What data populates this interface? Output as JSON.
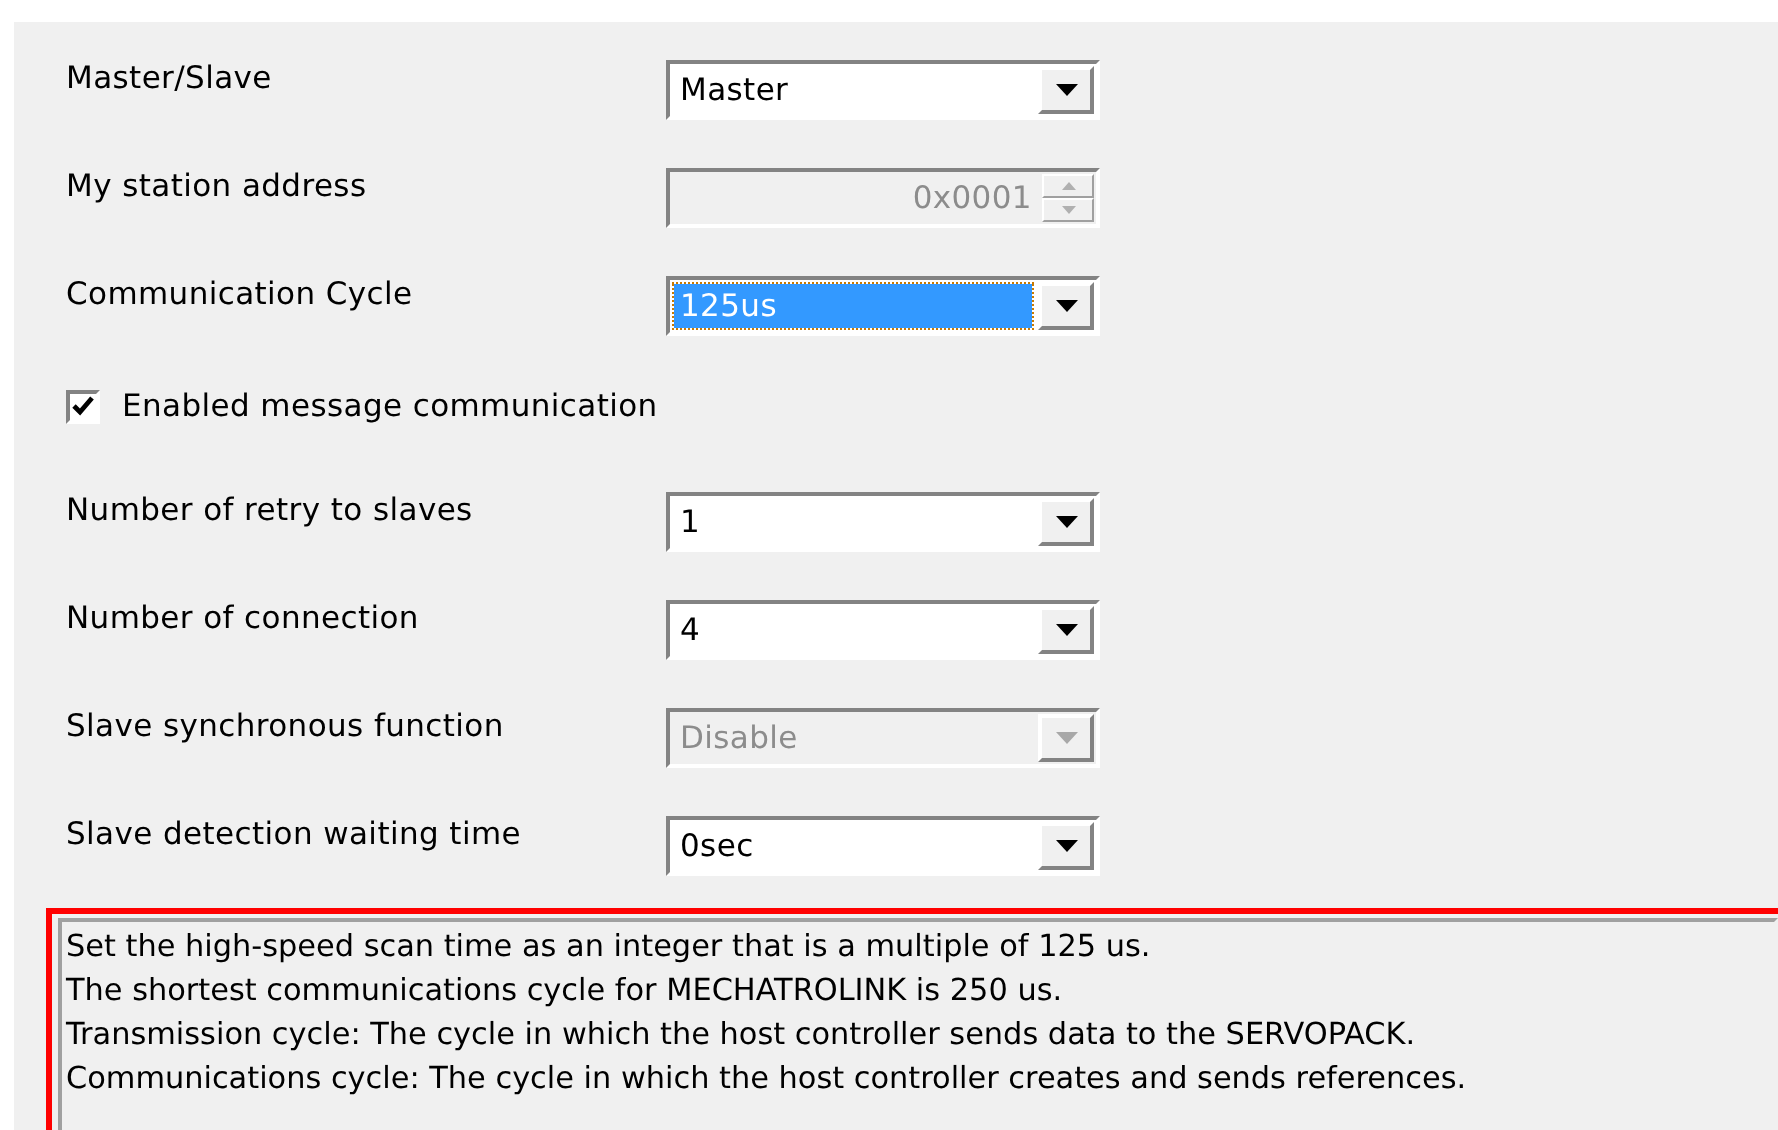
{
  "fields": [
    {
      "kind": "dropdown",
      "label": "Master/Slave",
      "value": "Master",
      "disabled": false,
      "focused": false
    },
    {
      "kind": "spin",
      "label": "My station address",
      "value": "0x0001",
      "disabled": true
    },
    {
      "kind": "dropdown",
      "label": "Communication Cycle",
      "value": "125us",
      "disabled": false,
      "focused": true
    },
    {
      "kind": "checkbox",
      "label": "Enabled message communication",
      "checked": true
    },
    {
      "kind": "dropdown",
      "label": "Number of retry to slaves",
      "value": "1",
      "disabled": false,
      "focused": false
    },
    {
      "kind": "dropdown",
      "label": "Number of connection",
      "value": "4",
      "disabled": false,
      "focused": false
    },
    {
      "kind": "dropdown",
      "label": "Slave synchronous function",
      "value": "Disable",
      "disabled": true,
      "focused": false
    },
    {
      "kind": "dropdown",
      "label": "Slave detection waiting time",
      "value": "0sec",
      "disabled": false,
      "focused": false
    }
  ],
  "description": {
    "lines": [
      "Set the high-speed scan time as an integer that is a multiple of 125 us.",
      "The shortest communications cycle for MECHATROLINK is 250 us.",
      "Transmission cycle: The cycle in which the host controller sends data to the SERVOPACK.",
      "Communications cycle: The cycle in which the host controller creates and sends references."
    ]
  }
}
